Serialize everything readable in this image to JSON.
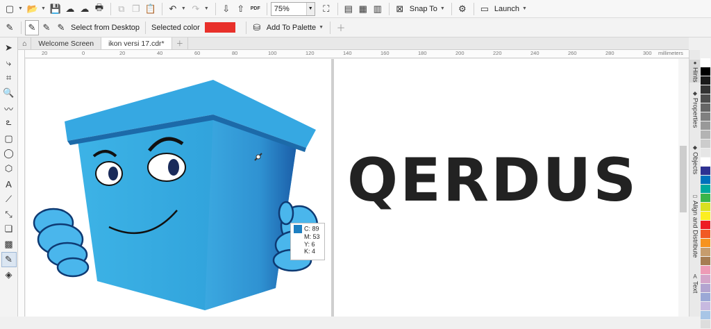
{
  "standard_toolbar": {
    "zoom_value": "75%",
    "snap_to_label": "Snap To",
    "launch_label": "Launch",
    "pdf_label": "PDF"
  },
  "property_bar": {
    "select_from_desktop_label": "Select from Desktop",
    "selected_color_label": "Selected color",
    "selected_color_value": "#e8302a",
    "add_to_palette_label": "Add To Palette"
  },
  "tabs": [
    {
      "label": "Welcome Screen",
      "active": false
    },
    {
      "label": "ikon versi 17.cdr*",
      "active": true
    }
  ],
  "ruler": {
    "ticks": [
      "20",
      "0",
      "20",
      "40",
      "60",
      "80",
      "100",
      "120",
      "140",
      "160",
      "180",
      "200",
      "220",
      "240",
      "260",
      "280",
      "300"
    ],
    "units": "millimeters"
  },
  "canvas": {
    "logo_text": "QERDUS",
    "color_tooltip": {
      "swatch": "#1d7fc1",
      "c": "C: 89",
      "m": "M: 53",
      "y": "Y: 6",
      "k": "K: 4"
    }
  },
  "dockers": [
    {
      "label": "Hints"
    },
    {
      "label": "Properties"
    },
    {
      "label": "Objects"
    },
    {
      "label": "Align and Distribute"
    },
    {
      "label": "Text"
    }
  ],
  "palette_colors": [
    "#ffffff",
    "#000000",
    "#1a1a1a",
    "#333333",
    "#4d4d4d",
    "#666666",
    "#808080",
    "#999999",
    "#b3b3b3",
    "#cccccc",
    "#e6e6e6",
    "#ffffff",
    "#2e3192",
    "#0071bc",
    "#00a99d",
    "#39b54a",
    "#d9e021",
    "#fcee21",
    "#ed1c24",
    "#f15a24",
    "#f7931e",
    "#c69c6d",
    "#a67c52",
    "#ee9bb6",
    "#d4a5c9",
    "#b3a4d0",
    "#9ba8d6",
    "#c7b9e0",
    "#a8c5e6",
    "#ddd"
  ]
}
